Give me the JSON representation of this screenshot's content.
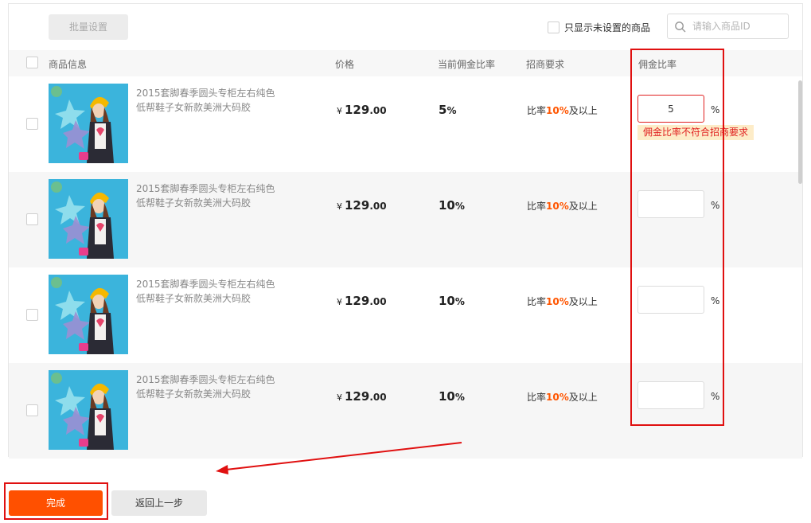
{
  "toolbar": {
    "batch_label": "批量设置",
    "filter_label": "只显示未设置的商品",
    "search_placeholder": "请输入商品ID"
  },
  "columns": {
    "product": "商品信息",
    "price": "价格",
    "current_rate": "当前佣金比率",
    "requirement": "招商要求",
    "commission": "佣金比率"
  },
  "rows": [
    {
      "title": "2015套脚春季圆头专柜左右纯色低帮鞋子女新款美洲大码胶",
      "price_currency": "¥",
      "price_int": "129",
      "price_dec": ".00",
      "rate_num": "5",
      "rate_unit": "%",
      "req_prefix": "比率",
      "req_value": "10%",
      "req_suffix": "及以上",
      "input_value": "5",
      "pct": "%",
      "error": "佣金比率不符合招商要求"
    },
    {
      "title": "2015套脚春季圆头专柜左右纯色低帮鞋子女新款美洲大码胶",
      "price_currency": "¥",
      "price_int": "129",
      "price_dec": ".00",
      "rate_num": "10",
      "rate_unit": "%",
      "req_prefix": "比率",
      "req_value": "10%",
      "req_suffix": "及以上",
      "input_value": "",
      "pct": "%"
    },
    {
      "title": "2015套脚春季圆头专柜左右纯色低帮鞋子女新款美洲大码胶",
      "price_currency": "¥",
      "price_int": "129",
      "price_dec": ".00",
      "rate_num": "10",
      "rate_unit": "%",
      "req_prefix": "比率",
      "req_value": "10%",
      "req_suffix": "及以上",
      "input_value": "",
      "pct": "%"
    },
    {
      "title": "2015套脚春季圆头专柜左右纯色低帮鞋子女新款美洲大码胶",
      "price_currency": "¥",
      "price_int": "129",
      "price_dec": ".00",
      "rate_num": "10",
      "rate_unit": "%",
      "req_prefix": "比率",
      "req_value": "10%",
      "req_suffix": "及以上",
      "input_value": "",
      "pct": "%"
    }
  ],
  "footer": {
    "done_label": "完成",
    "back_label": "返回上一步"
  },
  "colors": {
    "accent": "#ff5000",
    "highlight": "#ff5500",
    "error": "#e02020",
    "annotation": "#e01010"
  },
  "icons": {
    "search": "search-icon"
  }
}
